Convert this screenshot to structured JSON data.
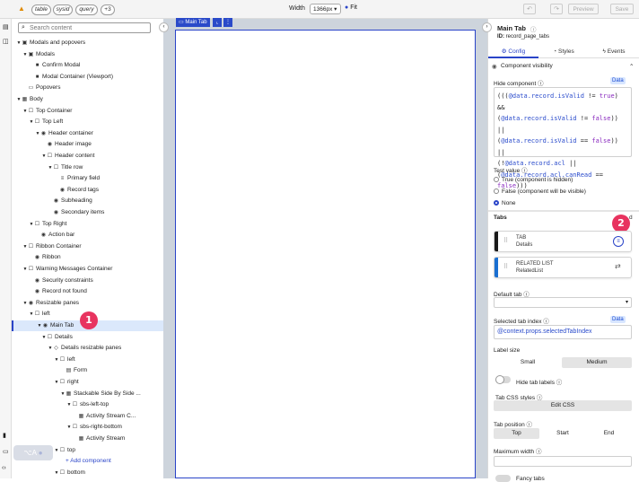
{
  "topbar": {
    "pills": [
      "table",
      "sysid",
      "query",
      "+3"
    ],
    "width_label": "Width",
    "width_value": "1366px",
    "fit_label": "Fit",
    "preview_label": "Preview",
    "save_label": "Save"
  },
  "tree": {
    "search_placeholder": "Search content",
    "rows": [
      {
        "label": "Modals and popovers",
        "indent": 0,
        "caret": "▼",
        "icon": "▣"
      },
      {
        "label": "Modals",
        "indent": 1,
        "caret": "▼",
        "icon": "▣"
      },
      {
        "label": "Confirm Modal",
        "indent": 2,
        "caret": "",
        "icon": "■"
      },
      {
        "label": "Modal Container (Viewport)",
        "indent": 2,
        "caret": "",
        "icon": "■"
      },
      {
        "label": "Popovers",
        "indent": 1,
        "caret": "",
        "icon": "▭"
      },
      {
        "label": "Body",
        "indent": 0,
        "caret": "▼",
        "icon": "▦"
      },
      {
        "label": "Top Container",
        "indent": 1,
        "caret": "▼",
        "icon": "☐"
      },
      {
        "label": "Top Left",
        "indent": 2,
        "caret": "▼",
        "icon": "☐"
      },
      {
        "label": "Header container",
        "indent": 3,
        "caret": "▼",
        "icon": "◉"
      },
      {
        "label": "Header image",
        "indent": 4,
        "caret": "",
        "icon": "◉"
      },
      {
        "label": "Header content",
        "indent": 4,
        "caret": "▼",
        "icon": "☐"
      },
      {
        "label": "Title row",
        "indent": 5,
        "caret": "▼",
        "icon": "☐"
      },
      {
        "label": "Primary field",
        "indent": 6,
        "caret": "",
        "icon": "≡"
      },
      {
        "label": "Record tags",
        "indent": 6,
        "caret": "",
        "icon": "◉"
      },
      {
        "label": "Subheading",
        "indent": 5,
        "caret": "",
        "icon": "◉"
      },
      {
        "label": "Secondary items",
        "indent": 5,
        "caret": "",
        "icon": "◉"
      },
      {
        "label": "Top Right",
        "indent": 2,
        "caret": "▼",
        "icon": "☐"
      },
      {
        "label": "Action bar",
        "indent": 3,
        "caret": "",
        "icon": "◉"
      },
      {
        "label": "Ribbon Container",
        "indent": 1,
        "caret": "▼",
        "icon": "☐"
      },
      {
        "label": "Ribbon",
        "indent": 2,
        "caret": "",
        "icon": "◉"
      },
      {
        "label": "Warning Messages Container",
        "indent": 1,
        "caret": "▼",
        "icon": "☐"
      },
      {
        "label": "Security constraints",
        "indent": 2,
        "caret": "",
        "icon": "◉"
      },
      {
        "label": "Record not found",
        "indent": 2,
        "caret": "",
        "icon": "◉"
      },
      {
        "label": "Resizable panes",
        "indent": 1,
        "caret": "▼",
        "icon": "◉"
      },
      {
        "label": "left",
        "indent": 2,
        "caret": "▼",
        "icon": "☐"
      },
      {
        "label": "Main Tab",
        "indent": 3,
        "caret": "▼",
        "icon": "◉",
        "selected": true
      },
      {
        "label": "Details",
        "indent": 4,
        "caret": "▼",
        "icon": "☐"
      },
      {
        "label": "Details resizable panes",
        "indent": 5,
        "caret": "▼",
        "icon": "◇"
      },
      {
        "label": "left",
        "indent": 6,
        "caret": "▼",
        "icon": "☐"
      },
      {
        "label": "Form",
        "indent": 7,
        "caret": "",
        "icon": "▤"
      },
      {
        "label": "right",
        "indent": 6,
        "caret": "▼",
        "icon": "☐"
      },
      {
        "label": "Stackable Side By Side ...",
        "indent": 7,
        "caret": "▼",
        "icon": "▦"
      },
      {
        "label": "sbs-left-top",
        "indent": 8,
        "caret": "▼",
        "icon": "☐"
      },
      {
        "label": "Activity Stream C...",
        "indent": 9,
        "caret": "",
        "icon": "▦"
      },
      {
        "label": "sbs-right-bottom",
        "indent": 8,
        "caret": "▼",
        "icon": "☐"
      },
      {
        "label": "Activity Stream",
        "indent": 9,
        "caret": "",
        "icon": "▦"
      },
      {
        "label": "top",
        "indent": 6,
        "caret": "▼",
        "icon": "☐"
      },
      {
        "label": "+ Add component",
        "indent": 7,
        "caret": "",
        "icon": "",
        "add": true
      },
      {
        "label": "bottom",
        "indent": 6,
        "caret": "▼",
        "icon": "☐"
      }
    ],
    "callout_1": "1",
    "bottom_button": "⌥A"
  },
  "canvas": {
    "chip_label": "Main Tab"
  },
  "panel": {
    "title": "Main Tab",
    "id_label": "ID:",
    "id_value": "record_page_tabs",
    "tabs": [
      "Config",
      "Styles",
      "Events"
    ],
    "section_visibility": "Component visibility",
    "hide_component_label": "Hide component",
    "data_badge": "Data",
    "hide_expr": [
      [
        [
          "(((",
          ""
        ],
        [
          "@data.record.isValid",
          "blue"
        ],
        [
          " != ",
          ""
        ],
        [
          "true",
          "purple"
        ],
        [
          ") &&",
          ""
        ]
      ],
      [
        [
          "(",
          ""
        ],
        [
          "@data.record.isValid",
          "blue"
        ],
        [
          " != ",
          ""
        ],
        [
          "false",
          "purple"
        ],
        [
          ")) ||",
          ""
        ]
      ],
      [
        [
          "(",
          ""
        ],
        [
          "@data.record.isValid",
          "blue"
        ],
        [
          " == ",
          ""
        ],
        [
          "false",
          "purple"
        ],
        [
          ")) ||",
          ""
        ]
      ],
      [
        [
          "(!",
          ""
        ],
        [
          "@data.record.acl",
          "blue"
        ],
        [
          " ||",
          ""
        ]
      ],
      [
        [
          "(",
          ""
        ],
        [
          "@data.record.acl.canRead",
          "blue"
        ],
        [
          " == ",
          ""
        ],
        [
          "false",
          "purple"
        ],
        [
          ")))",
          ""
        ]
      ]
    ],
    "test_value_label": "Test value",
    "radio_options": [
      "True (component is hidden)",
      "False (component will be visible)",
      "None"
    ],
    "radio_selected": 2,
    "tabs_section": "Tabs",
    "add_label": "d",
    "callout_2": "2",
    "tab_items": [
      {
        "type": "TAB",
        "name": "Details",
        "color": "#1a1a1a"
      },
      {
        "type": "RELATED LIST",
        "name": "RelatedList",
        "color": "#1a6fd1"
      }
    ],
    "default_tab_label": "Default tab",
    "selected_tab_label": "Selected tab index",
    "selected_tab_value": "@context.props.selectedTabIndex",
    "label_size_label": "Label size",
    "label_size_options": [
      "Small",
      "Medium"
    ],
    "hide_tab_labels": "Hide tab labels",
    "tab_css_label": "Tab CSS styles",
    "edit_css": "Edit CSS",
    "tab_position_label": "Tab position",
    "tab_position_options": [
      "Top",
      "Start",
      "End"
    ],
    "max_width_label": "Maximum width",
    "bottom_partial": "Fancy tabs"
  },
  "colors": {
    "accent": "#2a44c8",
    "callout": "#e8335f",
    "selection": "#dbe8fb"
  }
}
